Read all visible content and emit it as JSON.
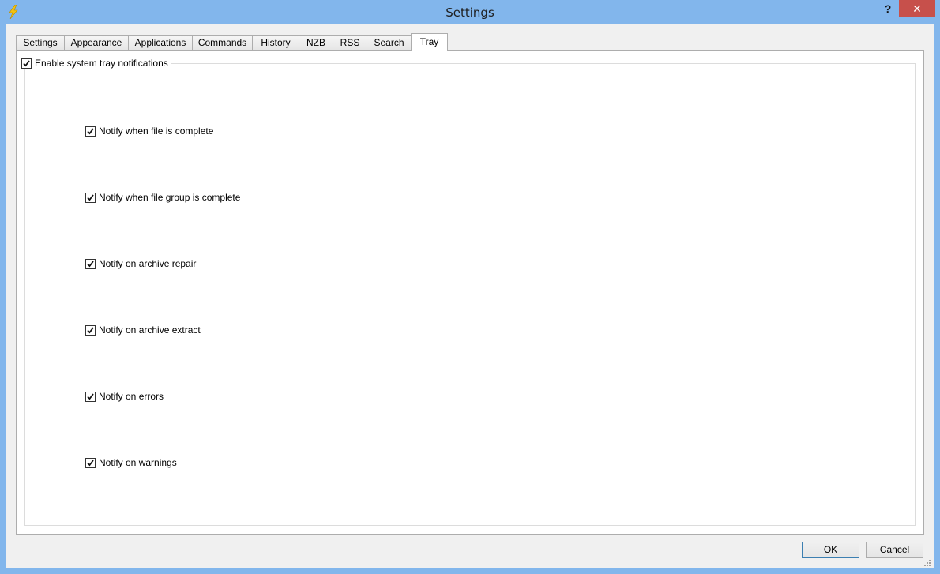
{
  "window": {
    "title": "Settings",
    "help_label": "?",
    "close_label": "✕",
    "frame_color": "#82b6ec",
    "close_color": "#c7504b"
  },
  "tabs": [
    {
      "label": "Settings",
      "active": false
    },
    {
      "label": "Appearance",
      "active": false
    },
    {
      "label": "Applications",
      "active": false
    },
    {
      "label": "Commands",
      "active": false
    },
    {
      "label": "History",
      "active": false
    },
    {
      "label": "NZB",
      "active": false
    },
    {
      "label": "RSS",
      "active": false
    },
    {
      "label": "Search",
      "active": false
    },
    {
      "label": "Tray",
      "active": true
    }
  ],
  "tray": {
    "enable": {
      "label": "Enable system tray notifications",
      "checked": true
    },
    "options": [
      {
        "label": "Notify when file is complete",
        "checked": true
      },
      {
        "label": "Notify when file group is complete",
        "checked": true
      },
      {
        "label": "Notify on archive repair",
        "checked": true
      },
      {
        "label": "Notify on archive extract",
        "checked": true
      },
      {
        "label": "Notify on errors",
        "checked": true
      },
      {
        "label": "Notify on warnings",
        "checked": true
      }
    ]
  },
  "buttons": {
    "ok": "OK",
    "cancel": "Cancel"
  },
  "icons": {
    "app": "lightning-bolt-icon",
    "check": "checkmark-icon",
    "grip": "resize-grip-icon"
  }
}
